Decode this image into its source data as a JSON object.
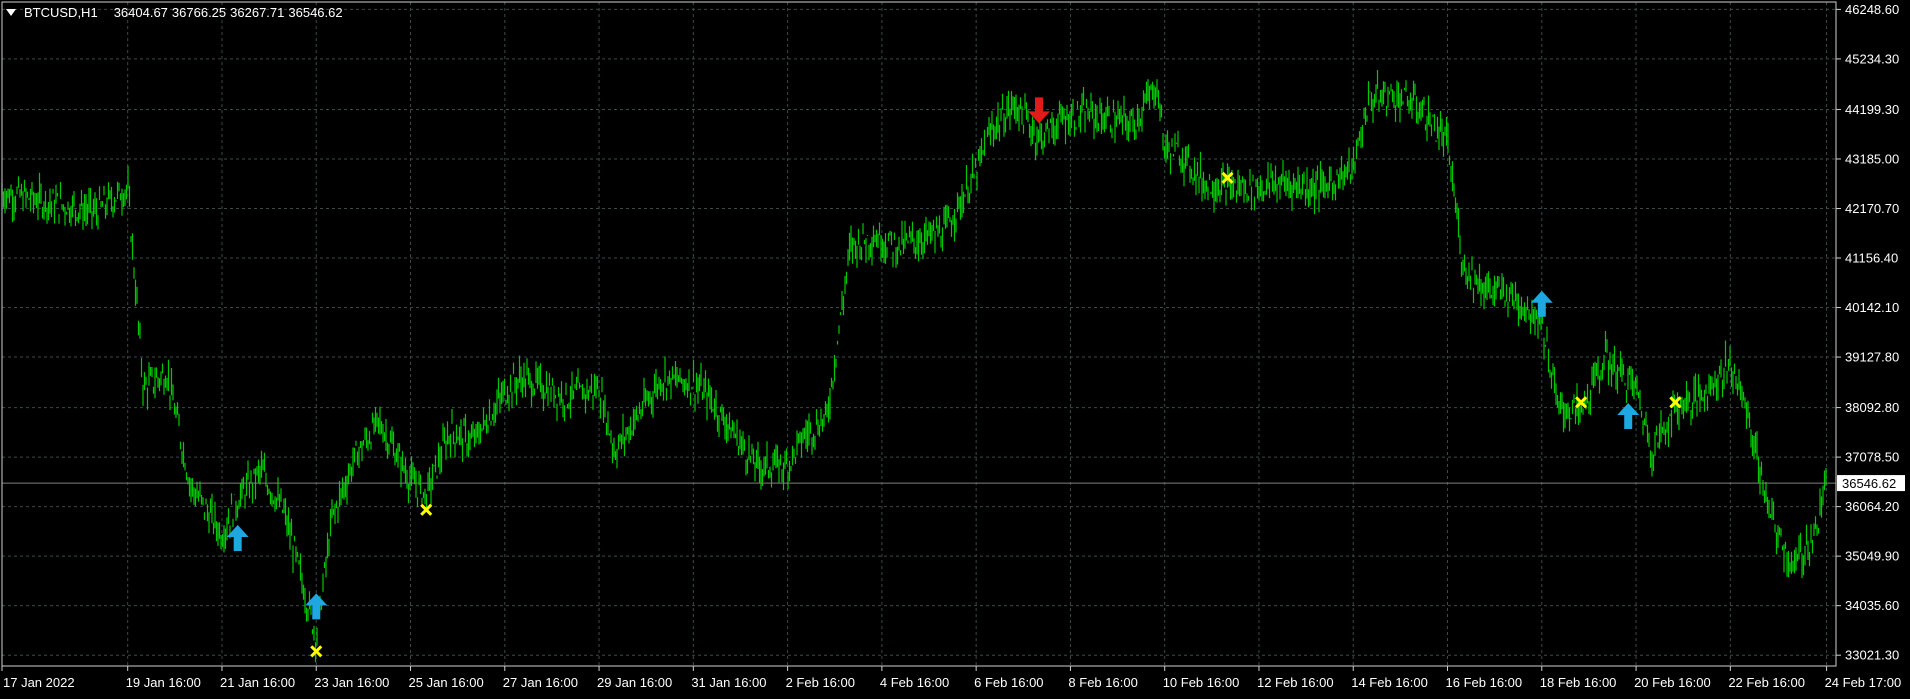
{
  "title": {
    "symbol": "BTCUSD,H1",
    "open": "36404.67",
    "high": "36766.25",
    "low": "36267.71",
    "close": "36546.62"
  },
  "price_axis": {
    "labels": [
      "46248.60",
      "45234.30",
      "44199.30",
      "43185.00",
      "42170.70",
      "41156.40",
      "40142.10",
      "39127.80",
      "38092.80",
      "37078.50",
      "36064.20",
      "35049.90",
      "34035.60",
      "33021.30"
    ],
    "current_price": "36546.62"
  },
  "time_axis": {
    "labels": [
      "17 Jan 2022",
      "19 Jan 16:00",
      "21 Jan 16:00",
      "23 Jan 16:00",
      "25 Jan 16:00",
      "27 Jan 16:00",
      "29 Jan 16:00",
      "31 Jan 16:00",
      "2 Feb 16:00",
      "4 Feb 16:00",
      "6 Feb 16:00",
      "8 Feb 16:00",
      "10 Feb 16:00",
      "12 Feb 16:00",
      "14 Feb 16:00",
      "16 Feb 16:00",
      "18 Feb 16:00",
      "20 Feb 16:00",
      "22 Feb 16:00",
      "24 Feb 17:00"
    ]
  },
  "colors": {
    "background": "#000000",
    "grid": "#3a4a4a",
    "bars": "#00c800",
    "buy_arrow": "#1ea7e1",
    "sell_arrow": "#e01b1b",
    "cross": "#ffff00",
    "price_line": "#7f7f7f",
    "text": "#ffffff"
  },
  "chart_data": {
    "type": "line",
    "series": [
      {
        "x": [
          "17 Jan",
          "18 Jan",
          "19 Jan",
          "19 Jan 16:00",
          "20 Jan",
          "20 Jan 12:00",
          "21 Jan",
          "21 Jan 16:00",
          "22 Jan",
          "22 Jan 12:00",
          "23 Jan",
          "23 Jan 16:00",
          "24 Jan",
          "24 Jan 12:00",
          "25 Jan",
          "25 Jan 16:00",
          "26 Jan",
          "26 Jan 12:00",
          "27 Jan",
          "27 Jan 16:00",
          "28 Jan",
          "29 Jan",
          "29 Jan 16:00",
          "30 Jan",
          "31 Jan",
          "31 Jan 16:00",
          "1 Feb",
          "2 Feb",
          "2 Feb 16:00",
          "3 Feb",
          "3 Feb 12:00",
          "4 Feb",
          "4 Feb 12:00",
          "5 Feb",
          "6 Feb",
          "6 Feb 16:00",
          "7 Feb",
          "7 Feb 12:00",
          "8 Feb",
          "8 Feb 12:00",
          "9 Feb",
          "10 Feb",
          "10 Feb 12:00",
          "10 Feb 16:00",
          "11 Feb",
          "11 Feb 12:00",
          "12 Feb",
          "12 Feb 16:00",
          "13 Feb",
          "14 Feb",
          "14 Feb 16:00",
          "15 Feb",
          "15 Feb 12:00",
          "16 Feb",
          "16 Feb 16:00",
          "17 Feb",
          "17 Feb 12:00",
          "18 Feb",
          "18 Feb 16:00",
          "19 Feb",
          "19 Feb 12:00",
          "20 Feb",
          "20 Feb 16:00",
          "21 Feb",
          "21 Feb 12:00",
          "22 Feb",
          "22 Feb 16:00",
          "23 Feb",
          "23 Feb 12:00",
          "24 Feb",
          "24 Feb 12:00",
          "24 Feb 17:00"
        ],
        "y": [
          42500,
          42300,
          42100,
          42600,
          38500,
          38800,
          36500,
          35500,
          36200,
          36800,
          35900,
          33400,
          35800,
          37100,
          37800,
          36600,
          36300,
          37600,
          37400,
          38400,
          38700,
          38300,
          38500,
          37200,
          38700,
          38600,
          38300,
          36900,
          36900,
          37500,
          37900,
          41400,
          41600,
          41400,
          41700,
          42900,
          43800,
          44300,
          43600,
          44000,
          44100,
          43900,
          44700,
          43400,
          43300,
          42700,
          42600,
          42600,
          42700,
          42600,
          43000,
          44400,
          44500,
          44300,
          43500,
          41000,
          40500,
          40400,
          39900,
          38100,
          38000,
          39100,
          38500,
          37200,
          38100,
          38300,
          39000,
          38100,
          35900,
          34800,
          35600,
          36546
        ]
      }
    ],
    "ylim": [
      32800,
      46400
    ],
    "signals": [
      {
        "type": "buy_arrow",
        "x": "22 Jan",
        "y": 35400
      },
      {
        "type": "buy_arrow",
        "x": "23 Jan 16:00",
        "y": 34000
      },
      {
        "type": "cross",
        "x": "23 Jan 16:00",
        "y": 33100
      },
      {
        "type": "cross",
        "x": "26 Jan",
        "y": 36000
      },
      {
        "type": "sell_arrow",
        "x": "8 Feb",
        "y": 44200
      },
      {
        "type": "cross",
        "x": "12 Feb",
        "y": 42800
      },
      {
        "type": "buy_arrow",
        "x": "18 Feb 16:00",
        "y": 40200
      },
      {
        "type": "cross",
        "x": "19 Feb 12:00",
        "y": 38200
      },
      {
        "type": "buy_arrow",
        "x": "20 Feb 12:00",
        "y": 37900
      },
      {
        "type": "cross",
        "x": "21 Feb 12:00",
        "y": 38200
      }
    ]
  }
}
